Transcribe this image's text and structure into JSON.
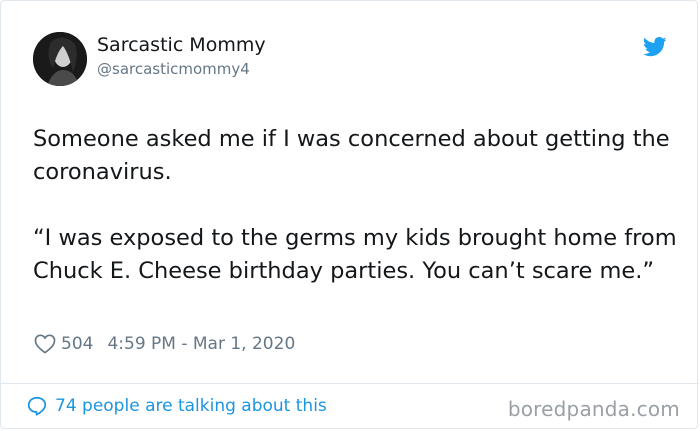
{
  "author": {
    "name": "Sarcastic Mommy",
    "handle": "@sarcasticmommy4"
  },
  "tweet": {
    "paragraphs": [
      "Someone asked me if I was concerned about getting the coronavirus.",
      "“I was exposed to the germs my kids brought home from Chuck E. Cheese birthday parties. You can’t scare me.”"
    ],
    "likes": "504",
    "timestamp": "4:59 PM - Mar 1, 2020"
  },
  "footer": {
    "talking": "74 people are talking about this",
    "watermark": "boredpanda.com"
  },
  "icons": {
    "brand": "twitter-bird-icon",
    "like": "heart-icon",
    "reply": "speech-bubble-icon"
  },
  "colors": {
    "accent": "#1da1f2",
    "link": "#1b95e0",
    "muted": "#657786",
    "border": "#e1e8ed",
    "text": "#14171a"
  }
}
